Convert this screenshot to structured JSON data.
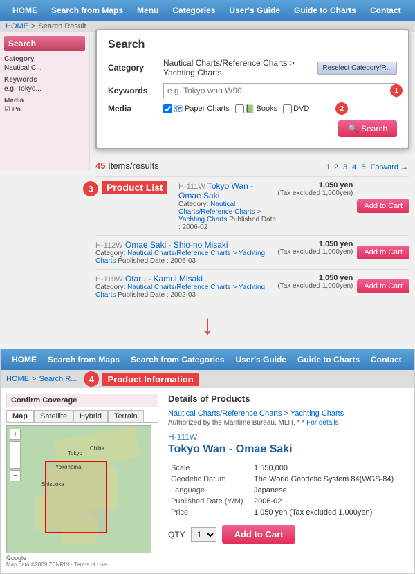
{
  "colors": {
    "nav_bg_start": "#5ba3d9",
    "nav_bg_end": "#3a7fc1",
    "accent_red": "#e84040",
    "link_blue": "#0066cc"
  },
  "top_nav": {
    "items": [
      "HOME",
      "Search from Maps",
      "Menu",
      "Categories",
      "User's Guide",
      "Guide to Charts",
      "Contact"
    ]
  },
  "breadcrumb": {
    "home": "HOME",
    "result": "Search Result"
  },
  "search_panel": {
    "title": "Search",
    "category_label": "Category",
    "category_value": "Nautical Charts/Reference Charts > Yachting Charts",
    "keywords_label": "Keywords",
    "keywords_placeholder": "e.g. Tokyo wan W90",
    "media_label": "Media",
    "media_options": [
      "Paper Charts",
      "Books",
      "DVD"
    ],
    "reselect_label": "Reselect Category/R...",
    "search_button": "Search",
    "circle1": "1",
    "circle2": "2"
  },
  "results": {
    "count": "45",
    "unit": "Items/results",
    "circle3": "3",
    "product_list_label": "Product List",
    "pages": [
      "1",
      "2",
      "3",
      "4",
      "5"
    ],
    "forward": "Forward →",
    "items": [
      {
        "code": "H-111W",
        "title": "Tokyo Wan - Omae Saki",
        "category": "Nautical Charts/Reference Charts > Yachting Charts",
        "published": "Published Date : 2006-02",
        "price": "1,050 yen",
        "price_note": "(Tax excluded 1,000yen)",
        "add_cart": "Add to Cart"
      },
      {
        "code": "H-112W",
        "title": "Omae Saki - Shio-no Misaki",
        "category": "Nautical Charts/Reference Charts > Yachting Charts",
        "published": "Published Date : 2006-03",
        "price": "1,050 yen",
        "price_note": "(Tax excluded 1,000yen)",
        "add_cart": "Add to Cart"
      },
      {
        "code": "H-119W",
        "title": "Otaru - Kamui Misaki",
        "category": "Nautical Charts/Reference Charts > Yachting Charts",
        "published": "Published Date : 2002-03",
        "price": "1,050 yen",
        "price_note": "(Tax excluded 1,000yen)",
        "add_cart": "Add to Cart"
      }
    ]
  },
  "lower_nav": {
    "items": [
      "HOME",
      "Search from Maps",
      "Search from Categories",
      "User's Guide",
      "Guide to Charts",
      "Contact"
    ]
  },
  "lower_breadcrumb": {
    "home": "HOME",
    "search": "Search R..."
  },
  "product_info": {
    "circle4": "4",
    "label": "Product Information",
    "map_title": "Confirm Coverage",
    "map_tabs": [
      "Map",
      "Satellite",
      "Hybrid",
      "Terrain"
    ],
    "details_title": "Details of Products",
    "category_path": "Nautical Charts/Reference Charts > Yachting Charts",
    "authorized": "Authorized by the Maritime Bureau, MLIT. * *",
    "for_details": "For details",
    "code": "H-111W",
    "title": "Tokyo Wan - Omae Saki",
    "scale_label": "Scale",
    "scale_value": "1:550,000",
    "geodetic_label": "Geodetic Datum",
    "geodetic_value": "The World Geodetic System 84(WGS-84)",
    "language_label": "Language",
    "language_value": "Japanese",
    "published_label": "Published Date (Y/M)",
    "published_value": "2006-02",
    "price_label": "Price",
    "price_value": "1,050 yen",
    "price_note": "(Tax excluded 1,000yen)",
    "qty_label": "QTY",
    "qty_value": "1",
    "add_cart": "Add to Cart",
    "map_logo": "Google",
    "map_copy": "Map data ©2009 ZENRIN · Terms of Use"
  }
}
